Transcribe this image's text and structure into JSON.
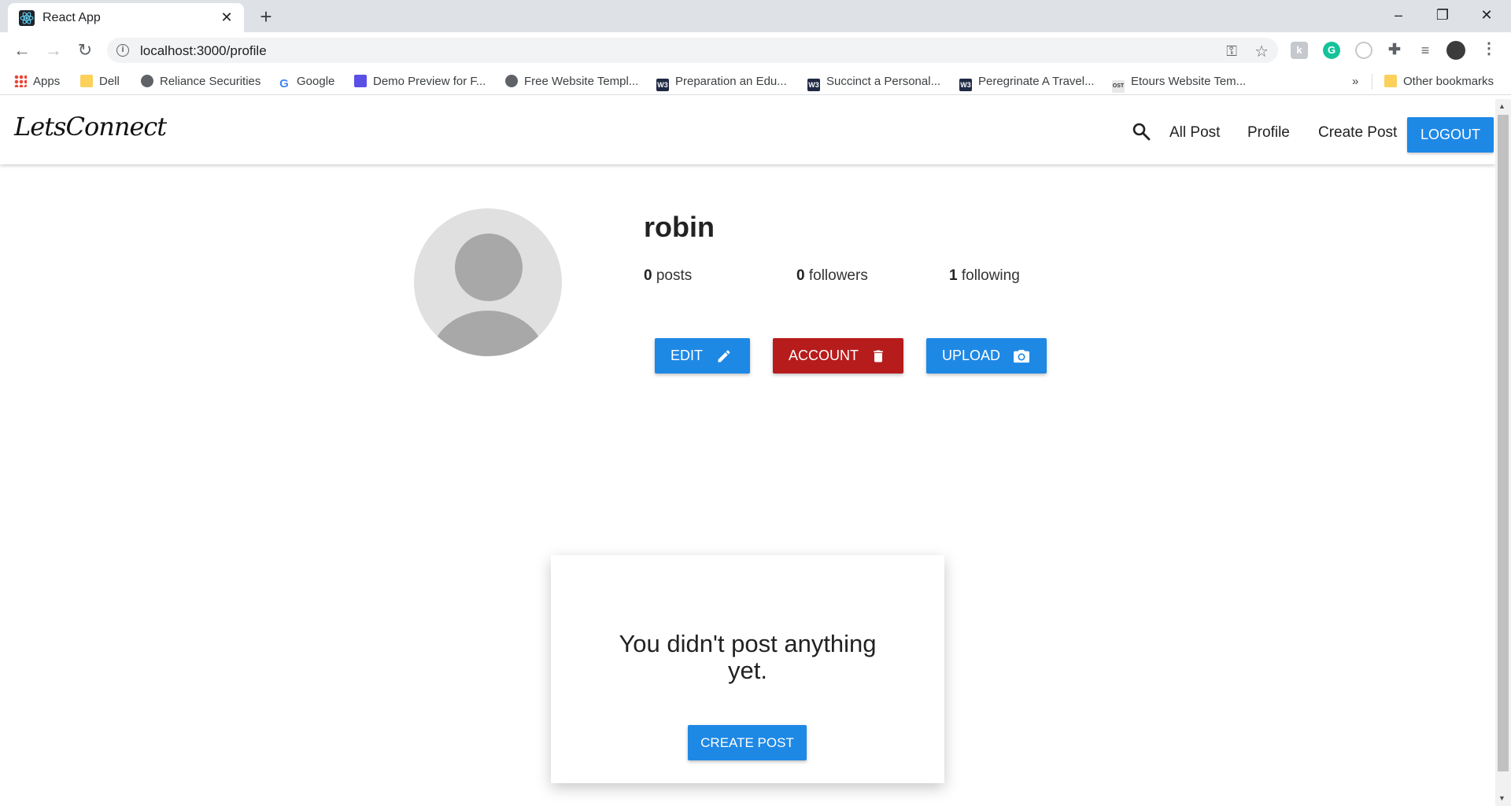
{
  "browser": {
    "tab_title": "React App",
    "url": "localhost:3000/profile",
    "bookmarks": [
      {
        "label": "Apps",
        "icon": "apps-grid-icon"
      },
      {
        "label": "Dell",
        "icon": "folder-icon"
      },
      {
        "label": "Reliance Securities",
        "icon": "globe-icon"
      },
      {
        "label": "Google",
        "icon": "google-icon"
      },
      {
        "label": "Demo Preview for F...",
        "icon": "demo-icon"
      },
      {
        "label": "Free Website Templ...",
        "icon": "globe-icon"
      },
      {
        "label": "Preparation an Edu...",
        "icon": "w3-icon"
      },
      {
        "label": "Succinct a Personal...",
        "icon": "w3-icon"
      },
      {
        "label": "Peregrinate A Travel...",
        "icon": "w3-icon"
      },
      {
        "label": "Etours Website Tem...",
        "icon": "ost-icon"
      }
    ],
    "bookmarks_more": "»",
    "other_bookmarks": "Other bookmarks"
  },
  "navbar": {
    "logo": "LetsConnect",
    "links": [
      "All Post",
      "Profile",
      "Create Post"
    ],
    "logout": "LOGOUT"
  },
  "profile": {
    "username": "robin",
    "stats": {
      "posts_count": "0",
      "posts_label": "posts",
      "followers_count": "0",
      "followers_label": "followers",
      "following_count": "1",
      "following_label": "following"
    },
    "buttons": {
      "edit": "EDIT",
      "account": "ACCOUNT",
      "upload": "UPLOAD"
    }
  },
  "empty_state": {
    "message": "You didn't post anything yet.",
    "create_post": "CREATE POST"
  },
  "colors": {
    "primary": "#1e88e5",
    "danger": "#b71c1c"
  }
}
